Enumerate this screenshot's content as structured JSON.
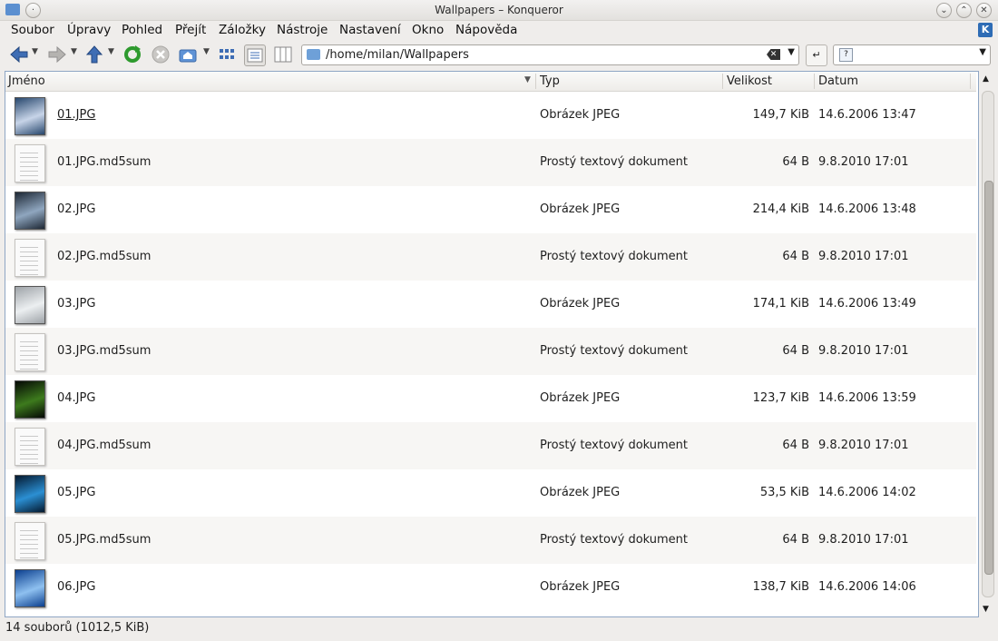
{
  "window": {
    "title": "Wallpapers – Konqueror"
  },
  "menu": [
    "Soubor",
    "Úpravy",
    "Pohled",
    "Přejít",
    "Záložky",
    "Nástroje",
    "Nastavení",
    "Okno",
    "Nápověda"
  ],
  "location": {
    "path": "/home/milan/Wallpapers"
  },
  "search": {
    "placeholder": ""
  },
  "columns": {
    "name": "Jméno",
    "type": "Typ",
    "size": "Velikost",
    "date": "Datum"
  },
  "files": [
    {
      "name": "01.JPG",
      "type": "Obrázek JPEG",
      "size": "149,7 KiB",
      "date": "14.6.2006 13:47",
      "kind": "image",
      "colors": [
        "#27476d",
        "#c7d4e8"
      ]
    },
    {
      "name": "01.JPG.md5sum",
      "type": "Prostý textový dokument",
      "size": "64 B",
      "date": "9.8.2010 17:01",
      "kind": "text"
    },
    {
      "name": "02.JPG",
      "type": "Obrázek JPEG",
      "size": "214,4 KiB",
      "date": "14.6.2006 13:48",
      "kind": "image",
      "colors": [
        "#1d2734",
        "#8fa6bf"
      ]
    },
    {
      "name": "02.JPG.md5sum",
      "type": "Prostý textový dokument",
      "size": "64 B",
      "date": "9.8.2010 17:01",
      "kind": "text"
    },
    {
      "name": "03.JPG",
      "type": "Obrázek JPEG",
      "size": "174,1 KiB",
      "date": "14.6.2006 13:49",
      "kind": "image",
      "colors": [
        "#9ea3a8",
        "#eceff1"
      ]
    },
    {
      "name": "03.JPG.md5sum",
      "type": "Prostý textový dokument",
      "size": "64 B",
      "date": "9.8.2010 17:01",
      "kind": "text"
    },
    {
      "name": "04.JPG",
      "type": "Obrázek JPEG",
      "size": "123,7 KiB",
      "date": "14.6.2006 13:59",
      "kind": "image",
      "colors": [
        "#050805",
        "#3d7a1d"
      ]
    },
    {
      "name": "04.JPG.md5sum",
      "type": "Prostý textový dokument",
      "size": "64 B",
      "date": "9.8.2010 17:01",
      "kind": "text"
    },
    {
      "name": "05.JPG",
      "type": "Obrázek JPEG",
      "size": "53,5 KiB",
      "date": "14.6.2006 14:02",
      "kind": "image",
      "colors": [
        "#04182e",
        "#2b8fd3"
      ]
    },
    {
      "name": "05.JPG.md5sum",
      "type": "Prostý textový dokument",
      "size": "64 B",
      "date": "9.8.2010 17:01",
      "kind": "text"
    },
    {
      "name": "06.JPG",
      "type": "Obrázek JPEG",
      "size": "138,7 KiB",
      "date": "14.6.2006 14:06",
      "kind": "image",
      "colors": [
        "#0b3f8f",
        "#8ec0f0"
      ]
    }
  ],
  "status": "14 souborů (1012,5 KiB)"
}
